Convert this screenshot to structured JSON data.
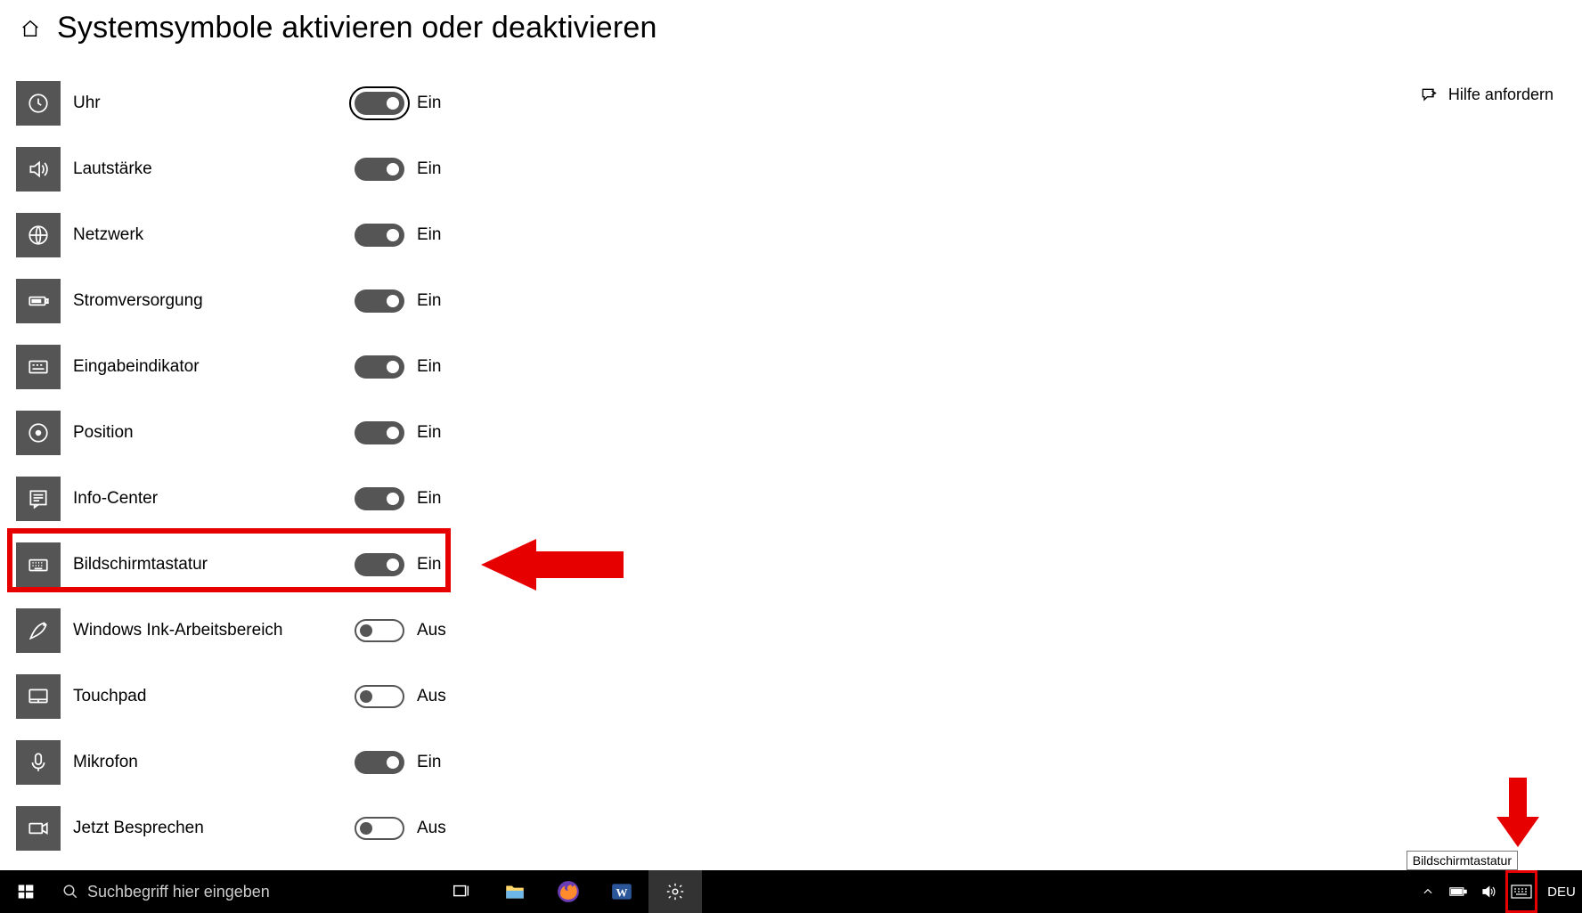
{
  "page": {
    "title": "Systemsymbole aktivieren oder deaktivieren"
  },
  "help": {
    "label": "Hilfe anfordern"
  },
  "toggle_state": {
    "on": "Ein",
    "off": "Aus"
  },
  "items": [
    {
      "icon": "clock-icon",
      "label": "Uhr",
      "state": "on",
      "focused": true
    },
    {
      "icon": "volume-icon",
      "label": "Lautstärke",
      "state": "on",
      "focused": false
    },
    {
      "icon": "network-icon",
      "label": "Netzwerk",
      "state": "on",
      "focused": false
    },
    {
      "icon": "power-icon",
      "label": "Stromversorgung",
      "state": "on",
      "focused": false
    },
    {
      "icon": "ime-icon",
      "label": "Eingabeindikator",
      "state": "on",
      "focused": false
    },
    {
      "icon": "location-icon",
      "label": "Position",
      "state": "on",
      "focused": false
    },
    {
      "icon": "info-icon",
      "label": "Info-Center",
      "state": "on",
      "focused": false
    },
    {
      "icon": "keyboard-icon",
      "label": "Bildschirmtastatur",
      "state": "on",
      "focused": false
    },
    {
      "icon": "ink-icon",
      "label": "Windows Ink-Arbeitsbereich",
      "state": "off",
      "focused": false
    },
    {
      "icon": "touchpad-icon",
      "label": "Touchpad",
      "state": "off",
      "focused": false
    },
    {
      "icon": "mic-icon",
      "label": "Mikrofon",
      "state": "on",
      "focused": false
    },
    {
      "icon": "meet-icon",
      "label": "Jetzt Besprechen",
      "state": "off",
      "focused": false
    }
  ],
  "taskbar": {
    "search_placeholder": "Suchbegriff hier eingeben",
    "lang": "DEU"
  },
  "tooltip": {
    "tray_keyboard": "Bildschirmtastatur"
  },
  "annotation": {
    "highlight_row_index": 7
  }
}
